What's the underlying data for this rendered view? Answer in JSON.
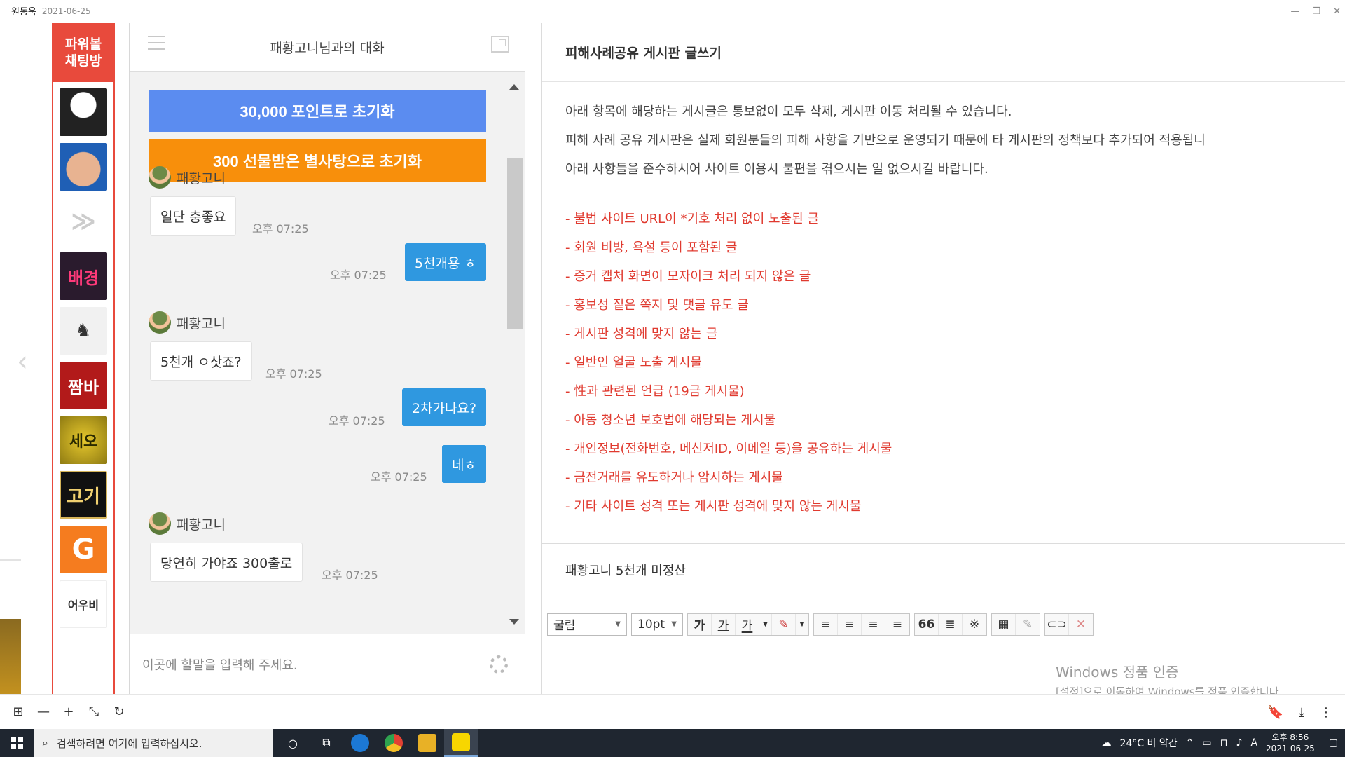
{
  "viewer": {
    "title": "원동욱",
    "date": "2021-06-25",
    "controls": [
      "—",
      "❐",
      "✕"
    ]
  },
  "sidebar": {
    "power_room_line1": "파워볼",
    "power_room_line2": "채팅방",
    "rooms": [
      {
        "name": "panda",
        "label": ""
      },
      {
        "name": "face",
        "label": ""
      },
      {
        "name": "logo",
        "label": "≫"
      },
      {
        "name": "neon",
        "label": "배경"
      },
      {
        "name": "anime",
        "label": "♞"
      },
      {
        "name": "jjam",
        "label": "짬바"
      },
      {
        "name": "seol",
        "label": "세오"
      },
      {
        "name": "gogi",
        "label": "고기"
      },
      {
        "name": "g",
        "label": "G"
      },
      {
        "name": "yu",
        "label": "어우비"
      }
    ]
  },
  "chat": {
    "title": "패황고니님과의 대화",
    "reset_points_label": "30,000 포인트로 초기화",
    "reset_candy_label": "300 선물받은 별사탕으로 초기화",
    "sender": "패황고니",
    "messages": [
      {
        "dir": "in",
        "text": "일단 충좋요",
        "time": "오후 07:25"
      },
      {
        "dir": "out",
        "text": "5천개용 ㅎ",
        "time": "오후 07:25"
      },
      {
        "dir": "in",
        "text": "5천개 ㅇ삿죠?",
        "time": "오후 07:25"
      },
      {
        "dir": "out",
        "text": "2차가나요?",
        "time": "오후 07:25"
      },
      {
        "dir": "out",
        "text": "네ㅎ",
        "time": "오후 07:25"
      },
      {
        "dir": "in",
        "text": "당연히 가야죠 300출로",
        "time": "오후 07:25"
      }
    ],
    "input_placeholder": "이곳에 할말을 입력해 주세요."
  },
  "content": {
    "title": "피해사례공유 게시판 글쓰기",
    "intro": [
      "아래 항목에 해당하는 게시글은 통보없이 모두 삭제, 게시판 이동 처리될 수 있습니다.",
      "피해 사례 공유 게시판은 실제 회원분들의 피해 사항을 기반으로 운영되기 때문에 타 게시판의 정책보다 추가되어 적용됩니",
      "아래 사항들을 준수하시어 사이트 이용시 불편을 겪으시는 일 없으시길 바랍니다."
    ],
    "rules": [
      "- 불법 사이트 URL이 *기호 처리 없이 노출된 글",
      "- 회원 비방, 욕설 등이 포함된 글",
      "- 증거 캡처 화면이 모자이크 처리 되지 않은 글",
      "- 홍보성 짙은 쪽지 및 댓글 유도 글",
      "- 게시판 성격에 맞지 않는 글",
      "- 일반인 얼굴 노출 게시물",
      "- 性과 관련된 언급 (19금 게시물)",
      "- 아동 청소년 보호법에 해당되는 게시물",
      "- 개인정보(전화번호, 메신저ID, 이메일 등)을 공유하는 게시물",
      "- 금전거래를 유도하거나 암시하는 게시물",
      "- 기타 사이트 성격 또는 게시판 성격에 맞지 않는 게시물"
    ],
    "subject": "패황고니 5천개 미정산",
    "editor": {
      "font": "굴림",
      "size": "10pt",
      "format_buttons": [
        "가",
        "가",
        "가"
      ],
      "align_buttons": [
        "≡",
        "≡",
        "≡",
        "≡"
      ],
      "insert_buttons": [
        "66",
        "≣",
        "※"
      ]
    },
    "watermark_title": "Windows 정품 인증",
    "watermark_sub": "[설정]으로 이동하여 Windows를 정품 인증합니다."
  },
  "viewer_toolbar": {
    "left": [
      "⊞",
      "—",
      "+",
      "⤡",
      "↻"
    ],
    "right": [
      "🔖",
      "⤓",
      "⋮"
    ]
  },
  "taskbar": {
    "search_placeholder": "검색하려면 여기에 입력하십시오.",
    "weather": "24°C  비 약간",
    "ime": "A",
    "time": "오후 8:56",
    "date": "2021-06-25",
    "colors": {
      "edge": "#1c78d4",
      "chrome": "#e34133",
      "files": "#e8b126",
      "kakao": "#f7d600"
    }
  }
}
